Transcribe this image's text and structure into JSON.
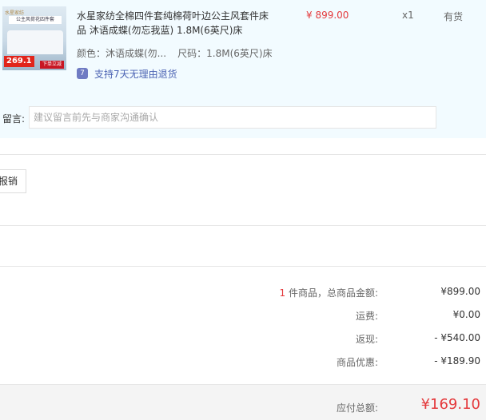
{
  "item": {
    "thumbnail": {
      "brand": "水星家纺",
      "title": "公主风荷花四件套",
      "price_tag": "269.1",
      "buy_label": "下单立减"
    },
    "name": "水星家纺全棉四件套纯棉荷叶边公主风套件床品 沐语成蝶(勿忘我蓝) 1.8M(6英尺)床",
    "unit_price": "¥ 899.00",
    "quantity": "x1",
    "stock": "有货",
    "color_attr": "颜色：沐语成蝶(勿...",
    "size_attr": "尺码：1.8M(6英尺)床",
    "return_badge": "7",
    "return_policy": "支持7天无理由退货"
  },
  "remark": {
    "label": "留言:",
    "placeholder": "建议留言前先与商家沟通确认"
  },
  "invoice": {
    "button_label": "报销"
  },
  "summary": {
    "item_count": "1",
    "goods_label_suffix": " 件商品，总商品金额:",
    "goods_total": "¥899.00",
    "shipping_label": "运费:",
    "shipping": "¥0.00",
    "cashback_label": "返现:",
    "cashback": "- ¥540.00",
    "discount_label": "商品优惠:",
    "discount": "- ¥189.90",
    "total_label": "应付总额:",
    "total": "¥169.10"
  },
  "colors": {
    "accent_red": "#e4393c",
    "panel_bg": "#f2fbff",
    "link_blue": "#4b63b3"
  }
}
